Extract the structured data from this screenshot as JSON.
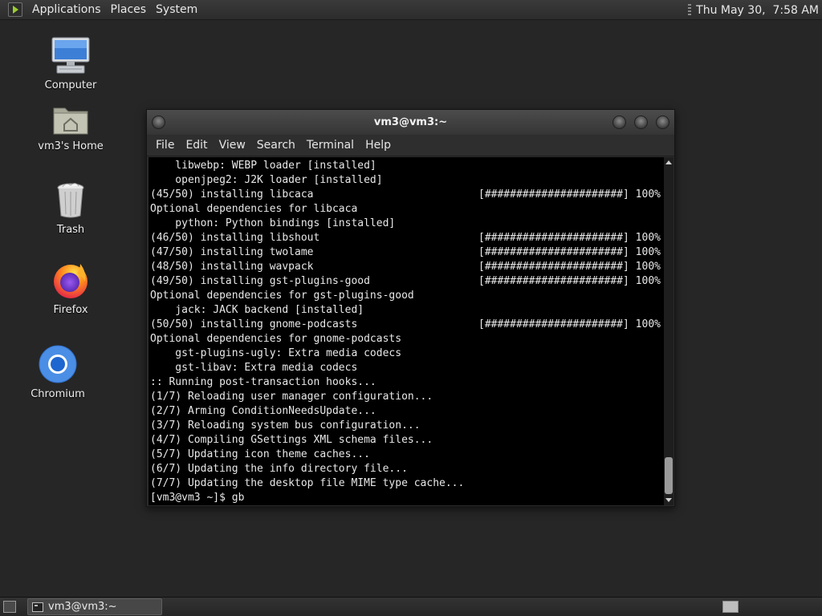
{
  "top_panel": {
    "menus": [
      "Applications",
      "Places",
      "System"
    ],
    "clock": "Thu May 30,  7:58 AM"
  },
  "desktop_icons": [
    {
      "label": "Computer",
      "icon": "computer-icon"
    },
    {
      "label": "vm3's Home",
      "icon": "home-folder-icon"
    },
    {
      "label": "Trash",
      "icon": "trash-icon"
    },
    {
      "label": "Firefox",
      "icon": "firefox-icon"
    },
    {
      "label": "Chromium",
      "icon": "chromium-icon"
    }
  ],
  "terminal": {
    "title": "vm3@vm3:~",
    "menus": [
      "File",
      "Edit",
      "View",
      "Search",
      "Terminal",
      "Help"
    ],
    "progress_bar": "[######################] 100%",
    "lines": [
      {
        "text": "    libwebp: WEBP loader [installed]"
      },
      {
        "text": "    openjpeg2: J2K loader [installed]"
      },
      {
        "text": "(45/50) installing libcaca",
        "progress": 1.0
      },
      {
        "text": "Optional dependencies for libcaca"
      },
      {
        "text": "    python: Python bindings [installed]"
      },
      {
        "text": "(46/50) installing libshout",
        "progress": 1.0
      },
      {
        "text": "(47/50) installing twolame",
        "progress": 1.0
      },
      {
        "text": "(48/50) installing wavpack",
        "progress": 1.0
      },
      {
        "text": "(49/50) installing gst-plugins-good",
        "progress": 1.0
      },
      {
        "text": "Optional dependencies for gst-plugins-good"
      },
      {
        "text": "    jack: JACK backend [installed]"
      },
      {
        "text": "(50/50) installing gnome-podcasts",
        "progress": 1.0
      },
      {
        "text": "Optional dependencies for gnome-podcasts"
      },
      {
        "text": "    gst-plugins-ugly: Extra media codecs"
      },
      {
        "text": "    gst-libav: Extra media codecs"
      },
      {
        "text": ":: Running post-transaction hooks..."
      },
      {
        "text": "(1/7) Reloading user manager configuration..."
      },
      {
        "text": "(2/7) Arming ConditionNeedsUpdate..."
      },
      {
        "text": "(3/7) Reloading system bus configuration..."
      },
      {
        "text": "(4/7) Compiling GSettings XML schema files..."
      },
      {
        "text": "(5/7) Updating icon theme caches..."
      },
      {
        "text": "(6/7) Updating the info directory file..."
      },
      {
        "text": "(7/7) Updating the desktop file MIME type cache..."
      },
      {
        "text": "[vm3@vm3 ~]$ gb"
      }
    ]
  },
  "taskbar": {
    "tasks": [
      {
        "label": "vm3@vm3:~",
        "icon": "terminal-icon"
      }
    ]
  },
  "colors": {
    "desktop_bg": "#262626",
    "terminal_bg": "#000000",
    "terminal_fg": "#e8e8e8"
  }
}
